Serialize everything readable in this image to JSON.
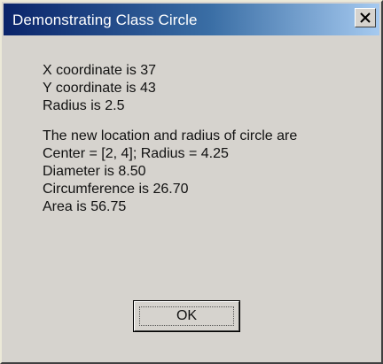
{
  "window": {
    "title": "Demonstrating Class Circle"
  },
  "content": {
    "lines": [
      "X coordinate is 37",
      "Y coordinate is 43",
      "Radius is 2.5",
      "The new location and radius of circle are",
      "Center = [2, 4]; Radius = 4.25",
      "Diameter is 8.50",
      "Circumference is 26.70",
      "Area is 56.75"
    ]
  },
  "buttons": {
    "ok_label": "OK"
  },
  "icons": {
    "close": "close-icon"
  },
  "colors": {
    "titlebar_start": "#0a246a",
    "titlebar_end": "#a6caf0",
    "window_bg": "#d6d3ce"
  }
}
